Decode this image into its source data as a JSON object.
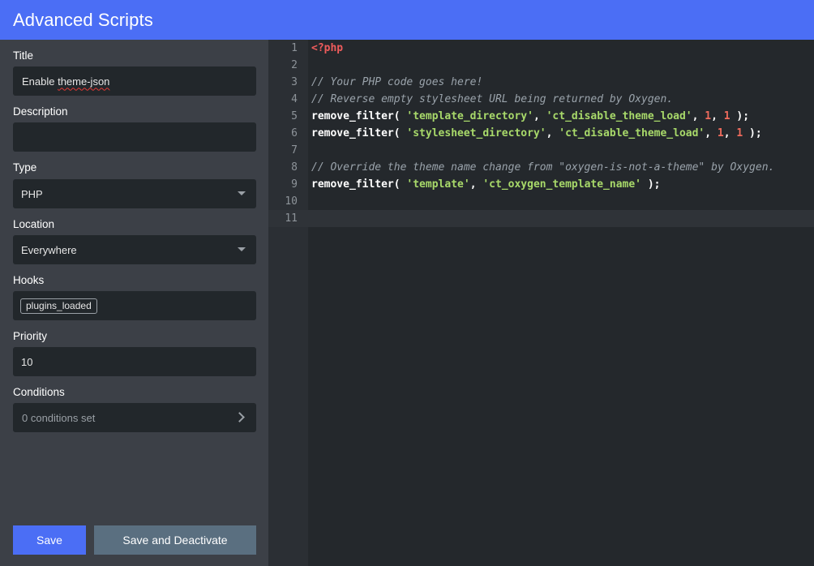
{
  "header": {
    "title": "Advanced Scripts"
  },
  "form": {
    "title": {
      "label": "Title",
      "value_pre": "Enable ",
      "value_spell": "theme-json"
    },
    "description": {
      "label": "Description",
      "value": ""
    },
    "type": {
      "label": "Type",
      "value": "PHP"
    },
    "location": {
      "label": "Location",
      "value": "Everywhere"
    },
    "hooks": {
      "label": "Hooks",
      "tags": [
        "plugins_loaded"
      ]
    },
    "priority": {
      "label": "Priority",
      "value": "10"
    },
    "conditions": {
      "label": "Conditions",
      "value": "0 conditions set"
    }
  },
  "buttons": {
    "save": "Save",
    "save_deactivate": "Save and Deactivate"
  },
  "editor": {
    "active_line": 11,
    "lines": [
      [
        {
          "t": "<?php",
          "c": "tag"
        }
      ],
      [],
      [
        {
          "t": "// Your PHP code goes here!",
          "c": "comment"
        }
      ],
      [
        {
          "t": "// Reverse empty stylesheet URL being returned by Oxygen.",
          "c": "comment"
        }
      ],
      [
        {
          "t": "remove_filter",
          "c": "fn"
        },
        {
          "t": "( ",
          "c": "punc"
        },
        {
          "t": "'template_directory'",
          "c": "str"
        },
        {
          "t": ", ",
          "c": "punc"
        },
        {
          "t": "'ct_disable_theme_load'",
          "c": "str"
        },
        {
          "t": ", ",
          "c": "punc"
        },
        {
          "t": "1",
          "c": "num"
        },
        {
          "t": ", ",
          "c": "punc"
        },
        {
          "t": "1",
          "c": "num"
        },
        {
          "t": " );",
          "c": "punc"
        }
      ],
      [
        {
          "t": "remove_filter",
          "c": "fn"
        },
        {
          "t": "( ",
          "c": "punc"
        },
        {
          "t": "'stylesheet_directory'",
          "c": "str"
        },
        {
          "t": ", ",
          "c": "punc"
        },
        {
          "t": "'ct_disable_theme_load'",
          "c": "str"
        },
        {
          "t": ", ",
          "c": "punc"
        },
        {
          "t": "1",
          "c": "num"
        },
        {
          "t": ", ",
          "c": "punc"
        },
        {
          "t": "1",
          "c": "num"
        },
        {
          "t": " );",
          "c": "punc"
        }
      ],
      [],
      [
        {
          "t": "// Override the theme name change from \"oxygen-is-not-a-theme\" by Oxygen.",
          "c": "comment"
        }
      ],
      [
        {
          "t": "remove_filter",
          "c": "fn"
        },
        {
          "t": "( ",
          "c": "punc"
        },
        {
          "t": "'template'",
          "c": "str"
        },
        {
          "t": ", ",
          "c": "punc"
        },
        {
          "t": "'ct_oxygen_template_name'",
          "c": "str"
        },
        {
          "t": " );",
          "c": "punc"
        }
      ],
      [],
      []
    ]
  }
}
